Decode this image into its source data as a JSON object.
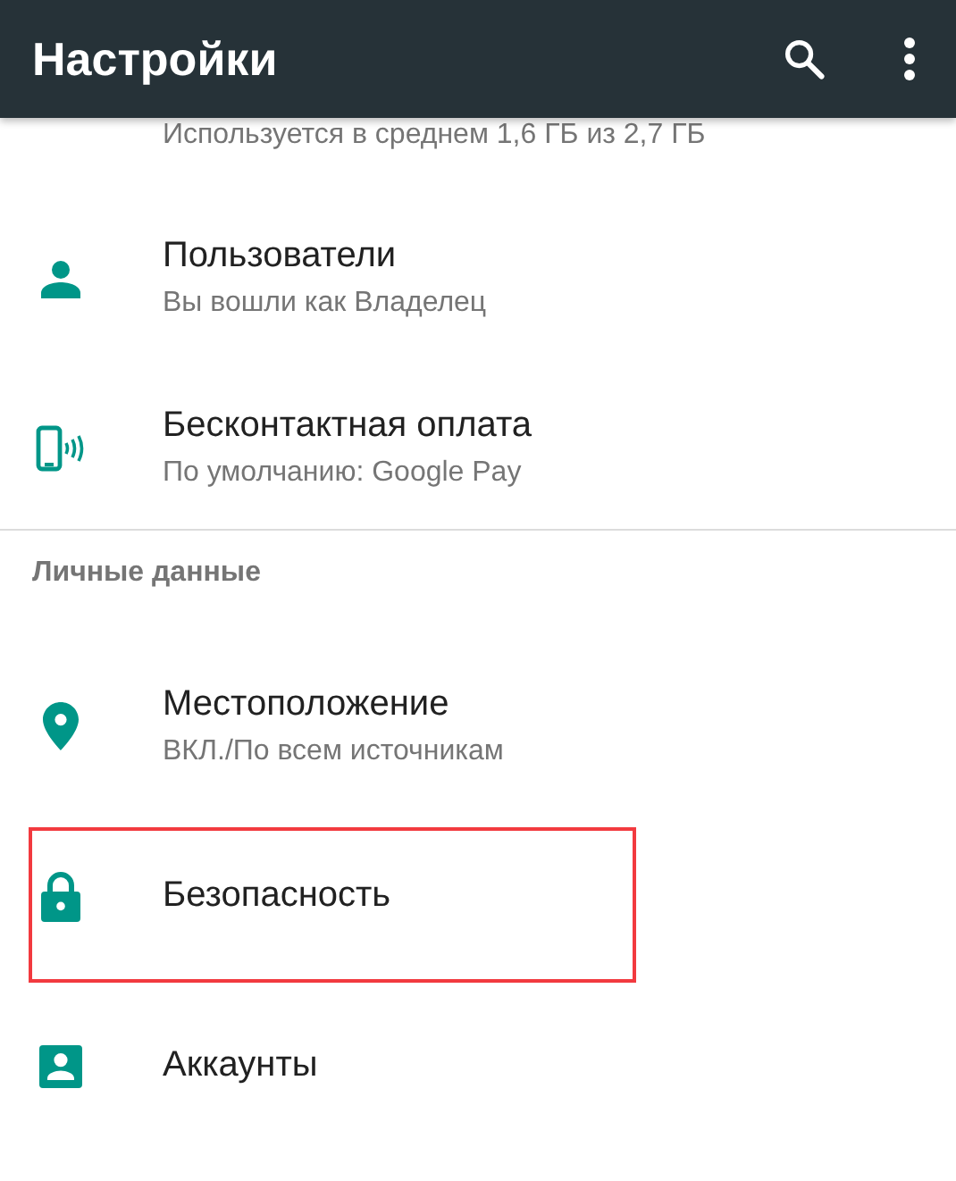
{
  "app_bar": {
    "title": "Настройки"
  },
  "sections": [
    {
      "items": [
        {
          "subtitle": "Используется в среднем 1,6 ГБ из 2,7 ГБ",
          "highlighted": false
        },
        {
          "kind": "person",
          "title": "Пользователи",
          "subtitle": "Вы вошли как Владелец",
          "highlighted": false
        },
        {
          "kind": "contactless",
          "title": "Бесконтактная оплата",
          "subtitle": "По умолчанию: Google Pay",
          "highlighted": false
        }
      ]
    },
    {
      "header": "Личные данные",
      "items": [
        {
          "kind": "location",
          "title": "Местоположение",
          "subtitle": "ВКЛ./По всем источникам",
          "highlighted": false
        },
        {
          "kind": "security",
          "title": "Безопасность",
          "highlighted": true
        },
        {
          "kind": "accounts",
          "title": "Аккаунты",
          "highlighted": false
        }
      ]
    }
  ]
}
